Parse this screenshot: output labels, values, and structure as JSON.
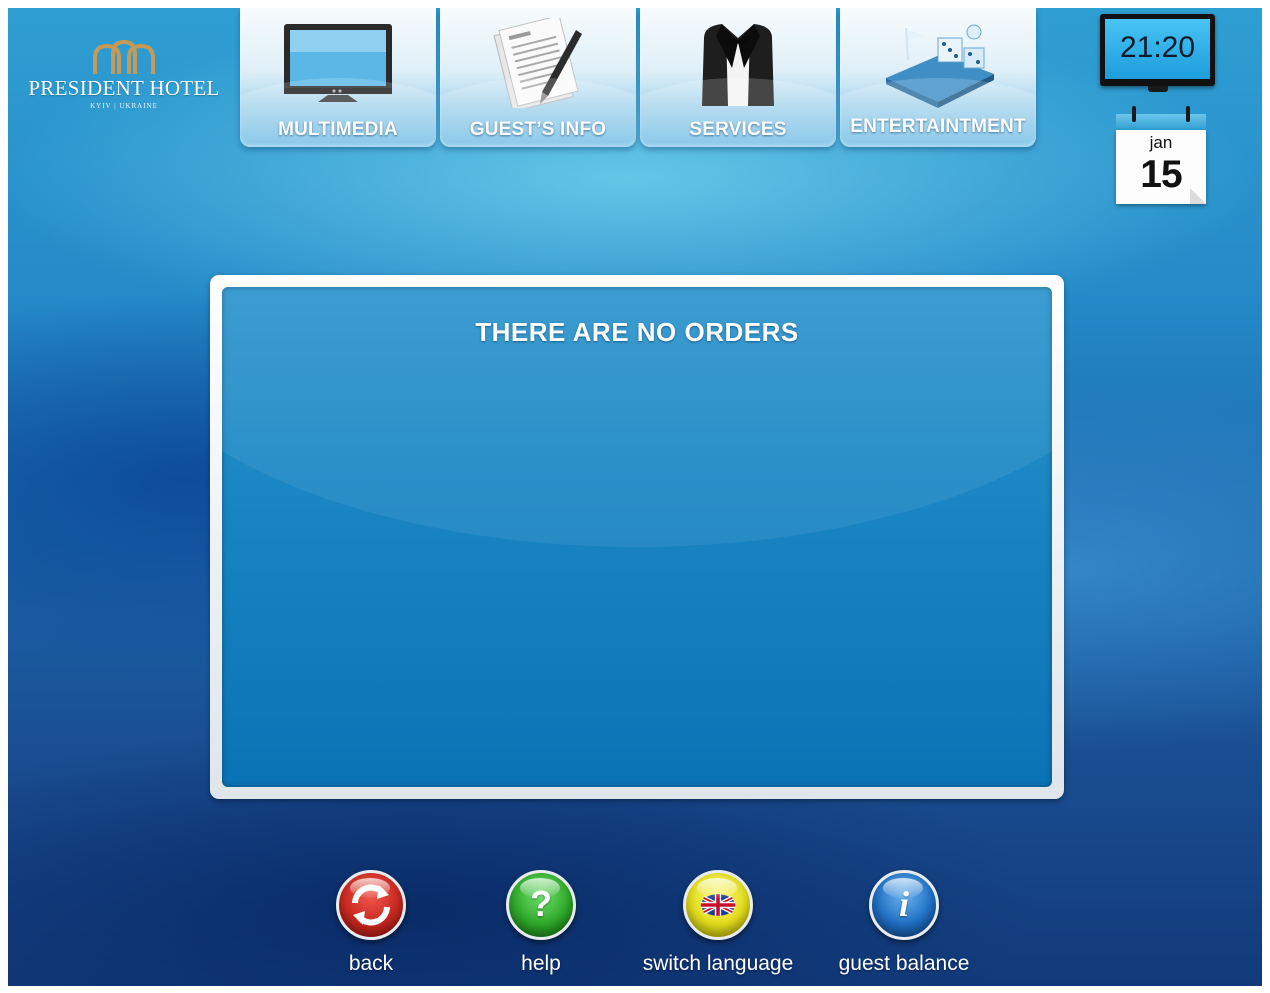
{
  "header": {
    "logo_name": "PRESIDENT HOTEL",
    "logo_sub": "KYIV | UKRAINE"
  },
  "nav": {
    "tabs": [
      {
        "label": "MULTIMEDIA",
        "icon": "tv-icon"
      },
      {
        "label": "GUEST’S INFO",
        "icon": "document-pen-icon"
      },
      {
        "label": "SERVICES",
        "icon": "tuxedo-icon"
      },
      {
        "label": "ENTERTAINTMENT",
        "icon": "casino-icon"
      }
    ]
  },
  "clock": {
    "time": "21:20"
  },
  "calendar": {
    "month": "jan",
    "day": "15"
  },
  "orders": {
    "message": "THERE ARE NO ORDERS"
  },
  "actions": {
    "back": "back",
    "help": "help",
    "switch_language": "switch language",
    "guest_balance": "guest balance"
  },
  "colors": {
    "back_button": "#c8281f",
    "help_button": "#2fa82a",
    "language_button": "#e3dc1c",
    "balance_button": "#1f6fc4",
    "panel_blue": "#1a86c3"
  }
}
